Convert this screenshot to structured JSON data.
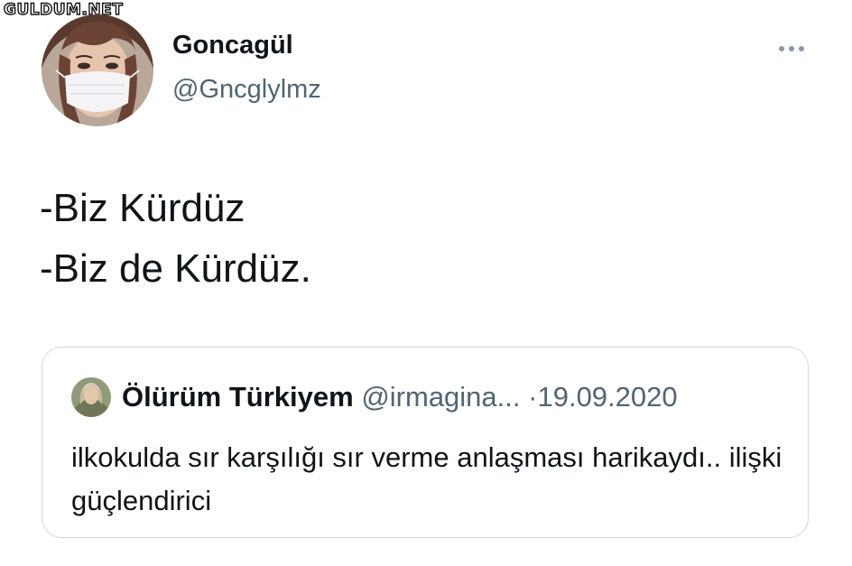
{
  "watermark": {
    "text": "GULDUM.NET"
  },
  "tweet": {
    "author": {
      "name": "Goncagül",
      "handle": "@Gncglylmz"
    },
    "more_icon": "more-horizontal-icon",
    "lines": [
      "-Biz Kürdüz",
      "-Biz de Kürdüz."
    ]
  },
  "quote": {
    "author": {
      "name": "Ölürüm Türkiyem",
      "handle": "@irmagina..."
    },
    "separator": "·",
    "date": "19.09.2020",
    "text": "ilkokulda sır karşılığı sır verme anlaşması harikaydı.. ilişki güçlendirici"
  },
  "colors": {
    "text_primary": "#0f1419",
    "text_secondary": "#536471",
    "border": "#cfd9de"
  }
}
